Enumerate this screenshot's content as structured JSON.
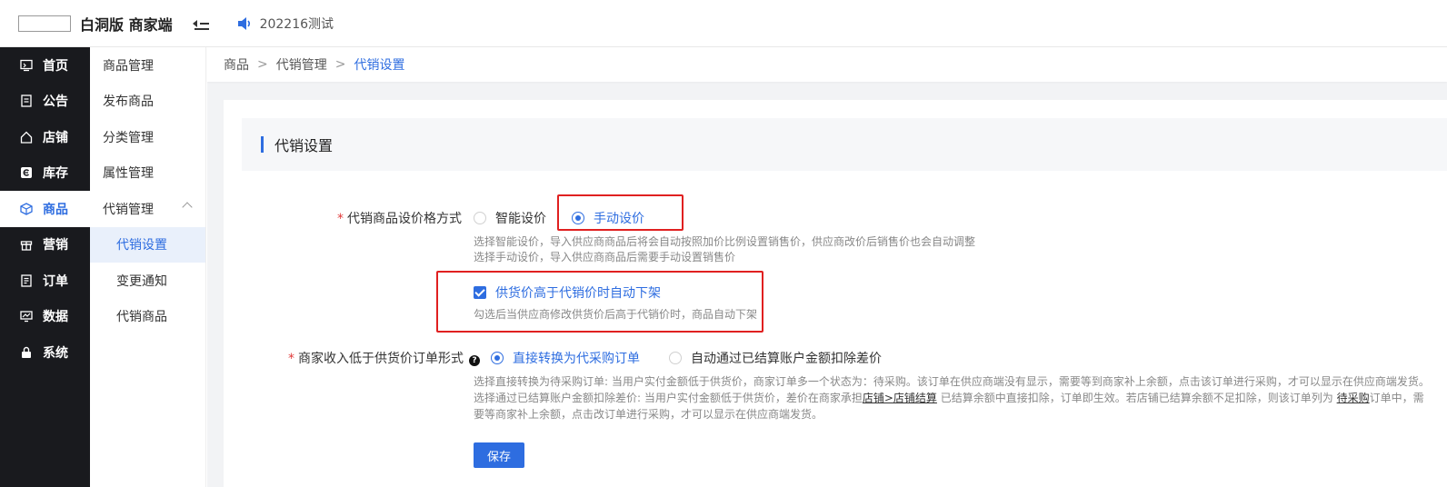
{
  "header": {
    "brand": "白洞版 商家端",
    "notice": "202216测试"
  },
  "sidebar": {
    "items": [
      {
        "label": "首页",
        "icon": "monitor-icon"
      },
      {
        "label": "公告",
        "icon": "document-icon"
      },
      {
        "label": "店铺",
        "icon": "home-icon"
      },
      {
        "label": "库存",
        "icon": "inventory-icon"
      },
      {
        "label": "商品",
        "icon": "cube-icon"
      },
      {
        "label": "营销",
        "icon": "gift-icon"
      },
      {
        "label": "订单",
        "icon": "order-icon"
      },
      {
        "label": "数据",
        "icon": "chart-icon"
      },
      {
        "label": "系统",
        "icon": "lock-icon"
      }
    ]
  },
  "subnav": {
    "items": [
      {
        "label": "商品管理"
      },
      {
        "label": "发布商品"
      },
      {
        "label": "分类管理"
      },
      {
        "label": "属性管理"
      },
      {
        "label": "代销管理"
      },
      {
        "label": "代销设置"
      },
      {
        "label": "变更通知"
      },
      {
        "label": "代销商品"
      }
    ]
  },
  "breadcrumb": [
    "商品",
    "代销管理",
    "代销设置"
  ],
  "section": {
    "title": "代销设置"
  },
  "form": {
    "pricing": {
      "label": "代销商品设价格方式",
      "options": [
        "智能设价",
        "手动设价"
      ],
      "selected": "手动设价",
      "hint_line1": "选择智能设价，导入供应商商品后将会自动按照加价比例设置销售价，供应商改价后销售价也会自动调整",
      "hint_line2": "选择手动设价，导入供应商商品后需要手动设置销售价"
    },
    "auto_delist": {
      "label": "供货价高于代销价时自动下架",
      "checked": true,
      "hint": "勾选后当供应商修改供货价后高于代销价时，商品自动下架"
    },
    "order_mode": {
      "label": "商家收入低于供货价订单形式",
      "options": [
        "直接转换为代采购订单",
        "自动通过已结算账户金额扣除差价"
      ],
      "selected": "直接转换为代采购订单",
      "hint_line1": "选择直接转换为待采购订单: 当用户实付金额低于供货价，商家订单多一个状态为：待采购。该订单在供应商端没有显示，需要等到商家补上余额，点击该订单进行采购，才可以显示在供应商端发货。",
      "hint_line2_a": "选择通过已结算账户金额扣除差价: 当用户实付金额低于供货价，差价在商家承担",
      "hint_line2_link": "店铺>店铺结算",
      "hint_line2_b": "已结算余额中直接扣除，订单即生效。若店铺已结算余额不足扣除，则该订单列为",
      "hint_line2_link2": "待采购",
      "hint_line2_c": "订单中，需",
      "hint_line3": "要等商家补上余额，点击改订单进行采购，才可以显示在供应商端发货。"
    },
    "save_label": "保存"
  }
}
